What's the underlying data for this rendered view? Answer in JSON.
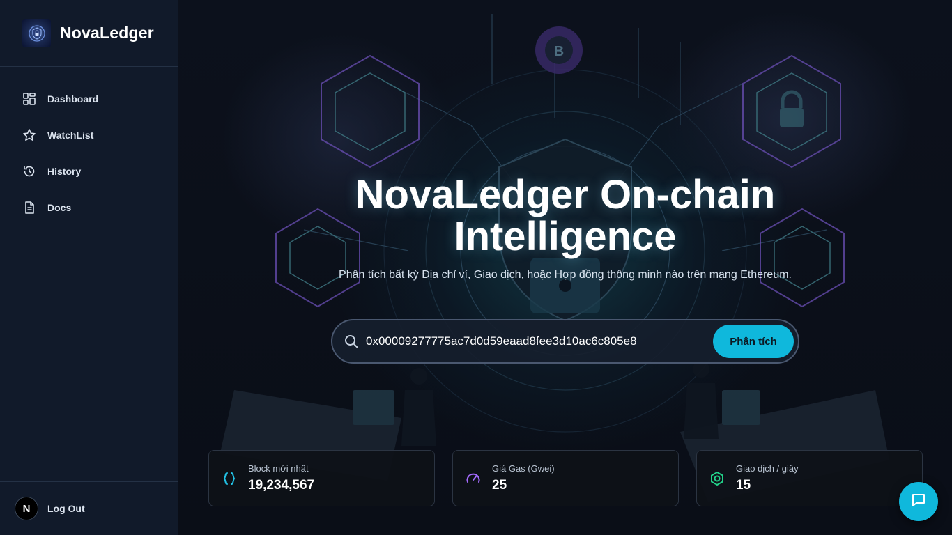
{
  "brand": {
    "name": "NovaLedger",
    "logo_icon": "shield-lock-logo"
  },
  "sidebar": {
    "items": [
      {
        "label": "Dashboard",
        "icon": "dashboard-icon"
      },
      {
        "label": "WatchList",
        "icon": "star-icon"
      },
      {
        "label": "History",
        "icon": "history-icon"
      },
      {
        "label": "Docs",
        "icon": "document-icon"
      }
    ],
    "user": {
      "avatar_letter": "N",
      "logout_label": "Log Out"
    }
  },
  "hero": {
    "title_line1": "NovaLedger On-chain",
    "title_line2": "Intelligence",
    "subtitle": "Phân tích bất kỳ Địa chỉ ví, Giao dịch, hoặc Hợp đồng thông minh nào trên mạng Ethereum."
  },
  "search": {
    "value": "0x00009277775ac7d0d59eaad8fee3d10ac6c805e8",
    "button_label": "Phân tích"
  },
  "stats": [
    {
      "label": "Block mới nhất",
      "value": "19,234,567",
      "icon": "braces-icon",
      "color": "#22c3e6"
    },
    {
      "label": "Giá Gas (Gwei)",
      "value": "25",
      "icon": "gauge-icon",
      "color": "#a46bff"
    },
    {
      "label": "Giao dịch / giây",
      "value": "15",
      "icon": "hexagon-icon",
      "color": "#22d38a"
    }
  ],
  "colors": {
    "accent": "#0fb8dc",
    "sidebar_bg": "#111a2a"
  }
}
